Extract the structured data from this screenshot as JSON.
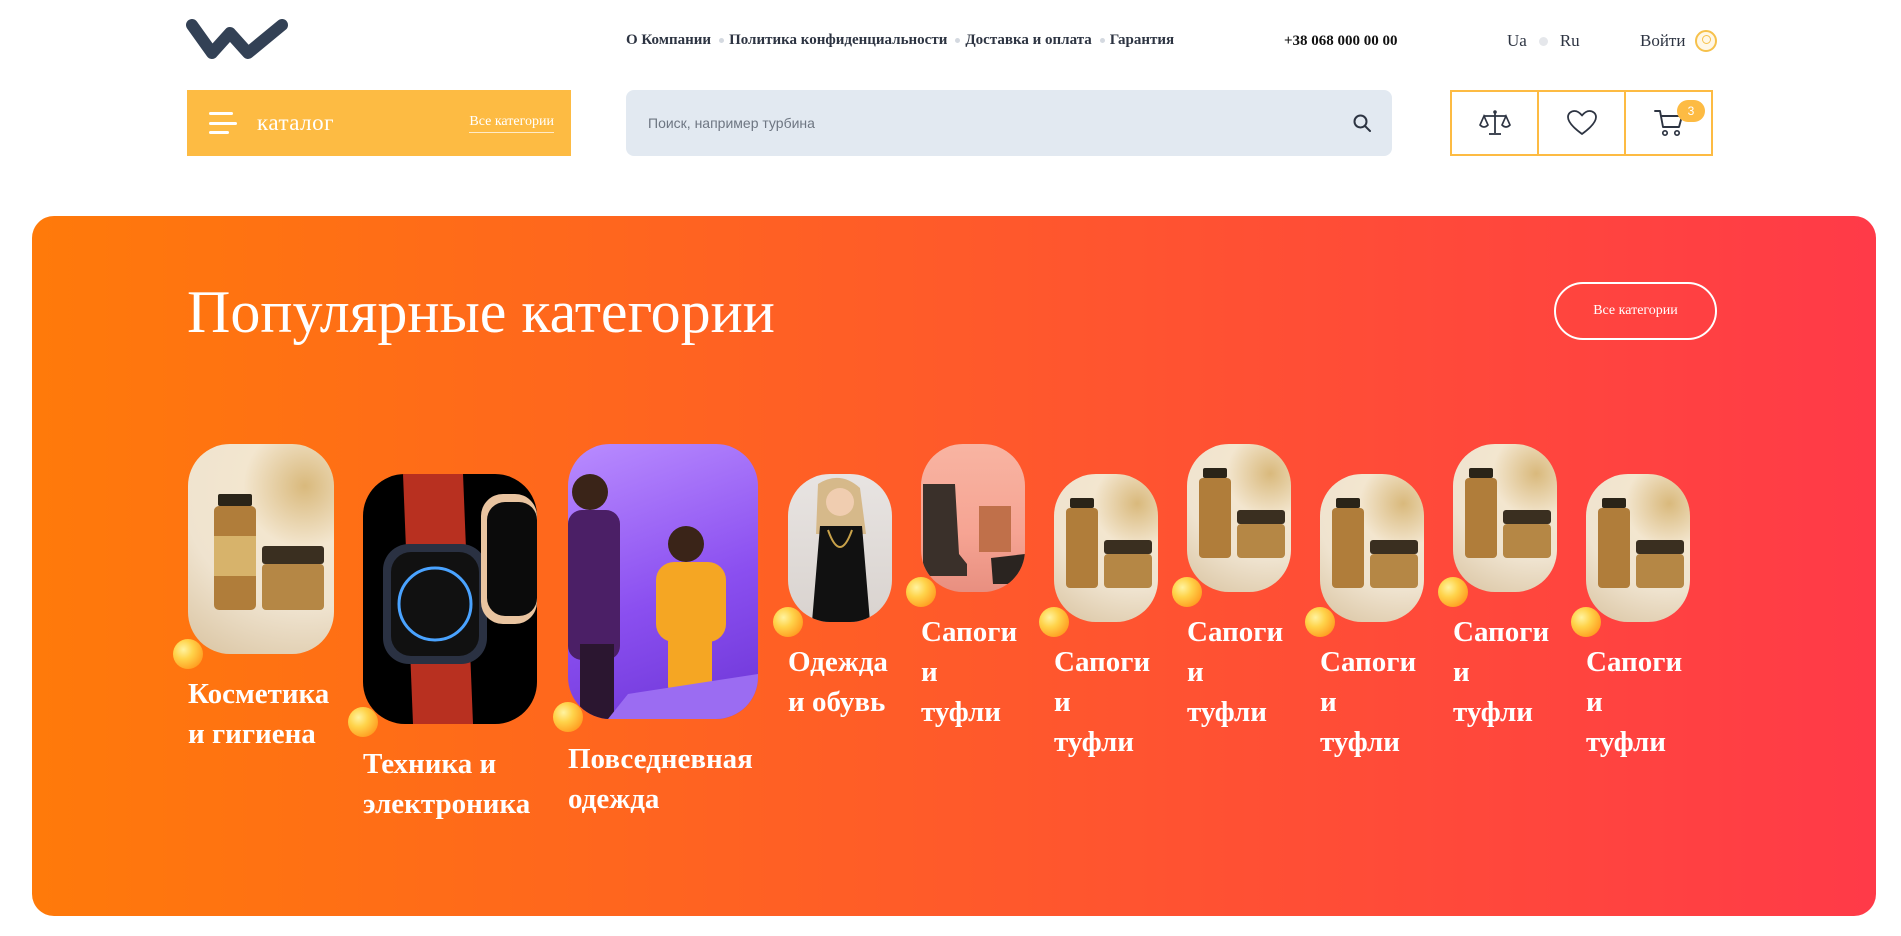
{
  "header": {
    "nav": [
      {
        "label": "О Компании"
      },
      {
        "label": "Политика конфиденциальности"
      },
      {
        "label": "Доставка и оплата"
      },
      {
        "label": "Гарантия"
      }
    ],
    "phone": "+38 068 000 00 00",
    "languages": [
      "Ua",
      "Ru"
    ],
    "login_label": "Войти"
  },
  "catalog": {
    "label": "каталог",
    "all_categories_link": "Все категории"
  },
  "search": {
    "placeholder": "Поиск, например турбина"
  },
  "actions": {
    "cart_count": "3"
  },
  "banner": {
    "title": "Популярные категории",
    "all_categories_button": "Все категории",
    "categories": [
      {
        "line1": "Косметика",
        "line2": "и гигиена",
        "image": "cosmetics"
      },
      {
        "line1": "Техника и",
        "line2": "электроника",
        "image": "smartwatch"
      },
      {
        "line1": "Повседневная",
        "line2": "одежда",
        "image": "fashion-couple"
      },
      {
        "line1": "Одежда",
        "line2": "и обувь",
        "image": "woman-black-dress"
      },
      {
        "line1": "Сапоги",
        "line2": "и",
        "line3": "туфли",
        "image": "boots"
      },
      {
        "line1": "Сапоги",
        "line2": "и",
        "line3": "туфли",
        "image": "cosmetics"
      },
      {
        "line1": "Сапоги",
        "line2": "и",
        "line3": "туфли",
        "image": "cosmetics"
      },
      {
        "line1": "Сапоги",
        "line2": "и",
        "line3": "туфли",
        "image": "cosmetics"
      },
      {
        "line1": "Сапоги",
        "line2": "и",
        "line3": "туфли",
        "image": "cosmetics"
      },
      {
        "line1": "Сапоги",
        "line2": "и",
        "line3": "туфли",
        "image": "cosmetics"
      }
    ]
  },
  "colors": {
    "accent": "#fdbb43",
    "banner_start": "#ff7a0a",
    "banner_end": "#ff3a48",
    "text_dark": "#2d3442",
    "search_bg": "#e2e9f1"
  }
}
